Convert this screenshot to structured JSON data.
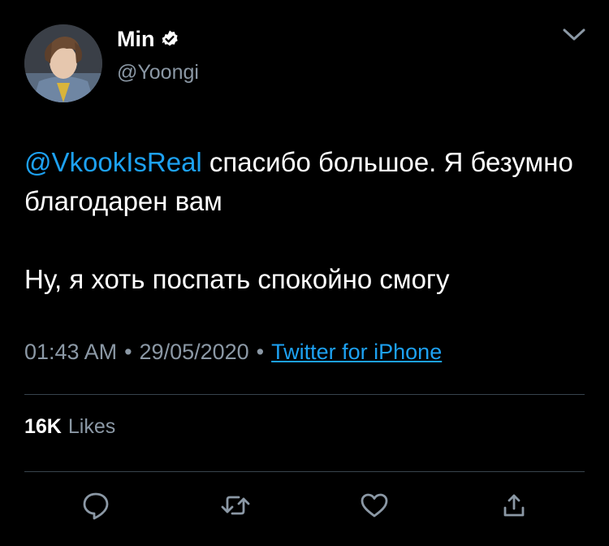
{
  "author": {
    "display_name": "Min",
    "handle": "@Yoongi",
    "verified": true,
    "avatar_icon": "profile-photo"
  },
  "tweet": {
    "mention": "@VkookIsReal",
    "line1_rest": " спасибо большое. Я безумно благодарен вам",
    "line2": "Ну, я хоть поспать спокойно смогу"
  },
  "meta": {
    "time": "01:43 AM",
    "separator": "•",
    "date": "29/05/2020",
    "source": "Twitter for iPhone"
  },
  "stats": {
    "likes_count": "16K",
    "likes_label": "Likes"
  },
  "icons": {
    "menu": "chevron-down-icon",
    "reply": "reply-icon",
    "retweet": "retweet-icon",
    "like": "heart-icon",
    "share": "share-icon"
  },
  "colors": {
    "background": "#000000",
    "text": "#ffffff",
    "secondary": "#8b98a5",
    "accent": "#1da1f2",
    "divider": "#38444d"
  }
}
